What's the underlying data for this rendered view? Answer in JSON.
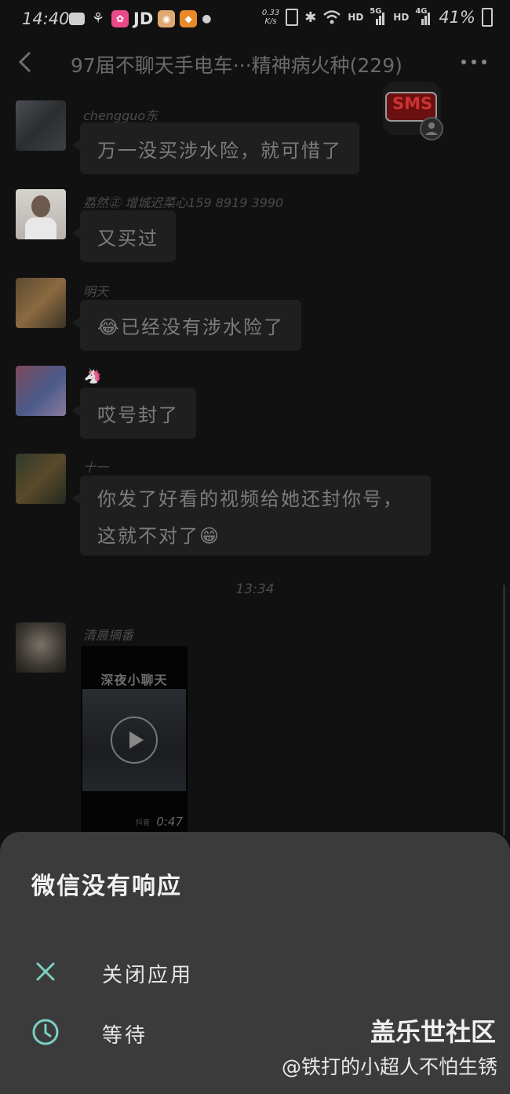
{
  "status": {
    "time": "14:40",
    "app_badges": [
      "JD"
    ],
    "net_speed_value": "0.33",
    "net_speed_unit": "K/s",
    "signal1": "HD",
    "signal1_gen": "5G",
    "signal2": "HD",
    "signal2_gen": "4G",
    "battery": "41%"
  },
  "header": {
    "title": "97届不聊天手电车···精神病火种(229)"
  },
  "sms_badge": "SMS",
  "messages": [
    {
      "sender": "chengguo东",
      "text": "万一没买涉水险，就可惜了"
    },
    {
      "sender": "荔然㊣ 增城迟菜心159 8919 3990",
      "text": "又买过"
    },
    {
      "sender": "明天",
      "text": "😂已经没有涉水险了"
    },
    {
      "sender": "🦄",
      "text": "哎号封了"
    },
    {
      "sender": "十一",
      "line1": "你发了好看的视频给她还封你号，",
      "line2": "这就不对了😁"
    }
  ],
  "time_separator": "13:34",
  "video_message": {
    "sender": "清晨摘番",
    "video_title": "深夜小聊天",
    "duration": "0:47",
    "source_label": "抖音"
  },
  "dialog": {
    "title": "微信没有响应",
    "close_label": "关闭应用",
    "wait_label": "等待"
  },
  "watermark": {
    "site": "盖乐世社区",
    "author": "@铁打的小超人不怕生锈"
  },
  "colors": {
    "background": "#111111",
    "dialog": "#3b3b3b",
    "accent": "#7ccfc4"
  }
}
